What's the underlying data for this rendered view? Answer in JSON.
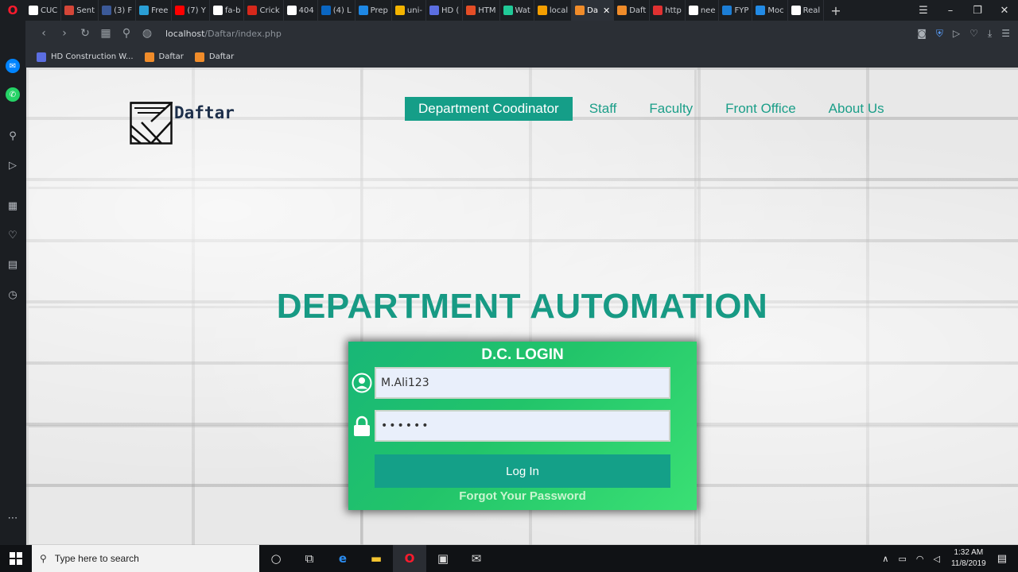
{
  "browser": {
    "tabs": [
      {
        "label": "CUC",
        "color": "#ffffff"
      },
      {
        "label": "Sent",
        "color": "#d44638"
      },
      {
        "label": "(3) F",
        "color": "#3b5998"
      },
      {
        "label": "Free",
        "color": "#2a9fd6"
      },
      {
        "label": "(7) Y",
        "color": "#ff0000"
      },
      {
        "label": "fa-b",
        "color": "#ffffff"
      },
      {
        "label": "Crick",
        "color": "#d6281b"
      },
      {
        "label": "404",
        "color": "#ffffff"
      },
      {
        "label": "(4) L",
        "color": "#0a66c2"
      },
      {
        "label": "Prep",
        "color": "#1e88e5"
      },
      {
        "label": "uni-",
        "color": "#f4b400"
      },
      {
        "label": "HD (",
        "color": "#5b6ee1"
      },
      {
        "label": "HTM",
        "color": "#e44d26"
      },
      {
        "label": "Wat",
        "color": "#20c997"
      },
      {
        "label": "local",
        "color": "#f59f00"
      },
      {
        "label": "Da",
        "color": "#f08c2a",
        "active": true
      },
      {
        "label": "Daft",
        "color": "#f08c2a"
      },
      {
        "label": "http",
        "color": "#e03131"
      },
      {
        "label": "nee",
        "color": "#ffffff"
      },
      {
        "label": "FYP",
        "color": "#1c7ed6"
      },
      {
        "label": "Moc",
        "color": "#228be6"
      },
      {
        "label": "Real",
        "color": "#ffffff"
      }
    ],
    "url_host": "localhost",
    "url_path": "/Daftar/index.php",
    "bookmarks": [
      {
        "label": "HD Construction W...",
        "color": "#5b6ee1"
      },
      {
        "label": "Daftar",
        "color": "#f08c2a"
      },
      {
        "label": "Daftar",
        "color": "#f08c2a"
      }
    ]
  },
  "site": {
    "logo_text": "Daftar",
    "nav": [
      {
        "label": "Department Coodinator",
        "active": true
      },
      {
        "label": "Staff"
      },
      {
        "label": "Faculty"
      },
      {
        "label": "Front Office"
      },
      {
        "label": "About Us"
      }
    ],
    "headline": "DEPARTMENT AUTOMATION",
    "login": {
      "title": "D.C. LOGIN",
      "username_value": "M.Ali123",
      "password_value": "••••••",
      "button_label": "Log In",
      "forgot_label": "Forgot Your Password"
    }
  },
  "taskbar": {
    "search_placeholder": "Type here to search",
    "time": "1:32 AM",
    "date": "11/8/2019"
  },
  "colors": {
    "accent": "#159e88",
    "card_green": "#22c46a"
  }
}
